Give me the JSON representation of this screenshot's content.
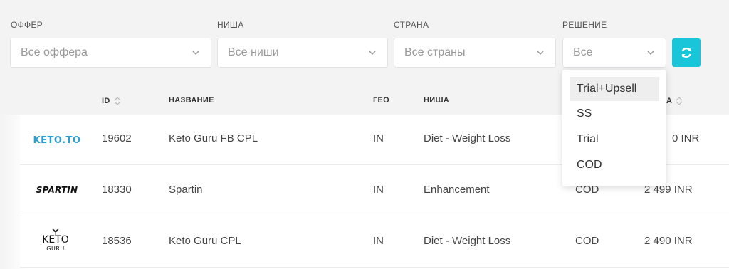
{
  "filters": {
    "offer": {
      "label": "ОФФЕР",
      "value": "Все оффера"
    },
    "niche": {
      "label": "НИША",
      "value": "Все ниши"
    },
    "country": {
      "label": "СТРАНА",
      "value": "Все страны"
    },
    "decision": {
      "label": "РЕШЕНИЕ",
      "value": "Все"
    }
  },
  "refresh_icon": "refresh-icon",
  "table": {
    "headers": {
      "id": "ID",
      "name": "НАЗВАНИЕ",
      "geo": "ГЕО",
      "niche": "НИША",
      "price_partial": "А"
    },
    "rows": [
      {
        "logo": "KETO.TO",
        "id": "19602",
        "name": "Keto Guru FB CPL",
        "geo": "IN",
        "niche": "Diet - Weight Loss",
        "decision": "",
        "price": "0 INR"
      },
      {
        "logo": "SPARTIN",
        "id": "18330",
        "name": "Spartin",
        "geo": "IN",
        "niche": "Enhancement",
        "decision": "COD",
        "price": "2 499 INR"
      },
      {
        "logo_line1": "KETO",
        "logo_line2": "GURU",
        "id": "18536",
        "name": "Keto Guru CPL",
        "geo": "IN",
        "niche": "Diet - Weight Loss",
        "decision": "COD",
        "price": "2 490 INR"
      }
    ]
  },
  "dropdown": {
    "options": [
      "Trial+Upsell",
      "SS",
      "Trial",
      "COD"
    ],
    "highlighted": "Trial+Upsell"
  },
  "colors": {
    "accent": "#19c5d8",
    "keto_logo": "#2a9fd6"
  }
}
